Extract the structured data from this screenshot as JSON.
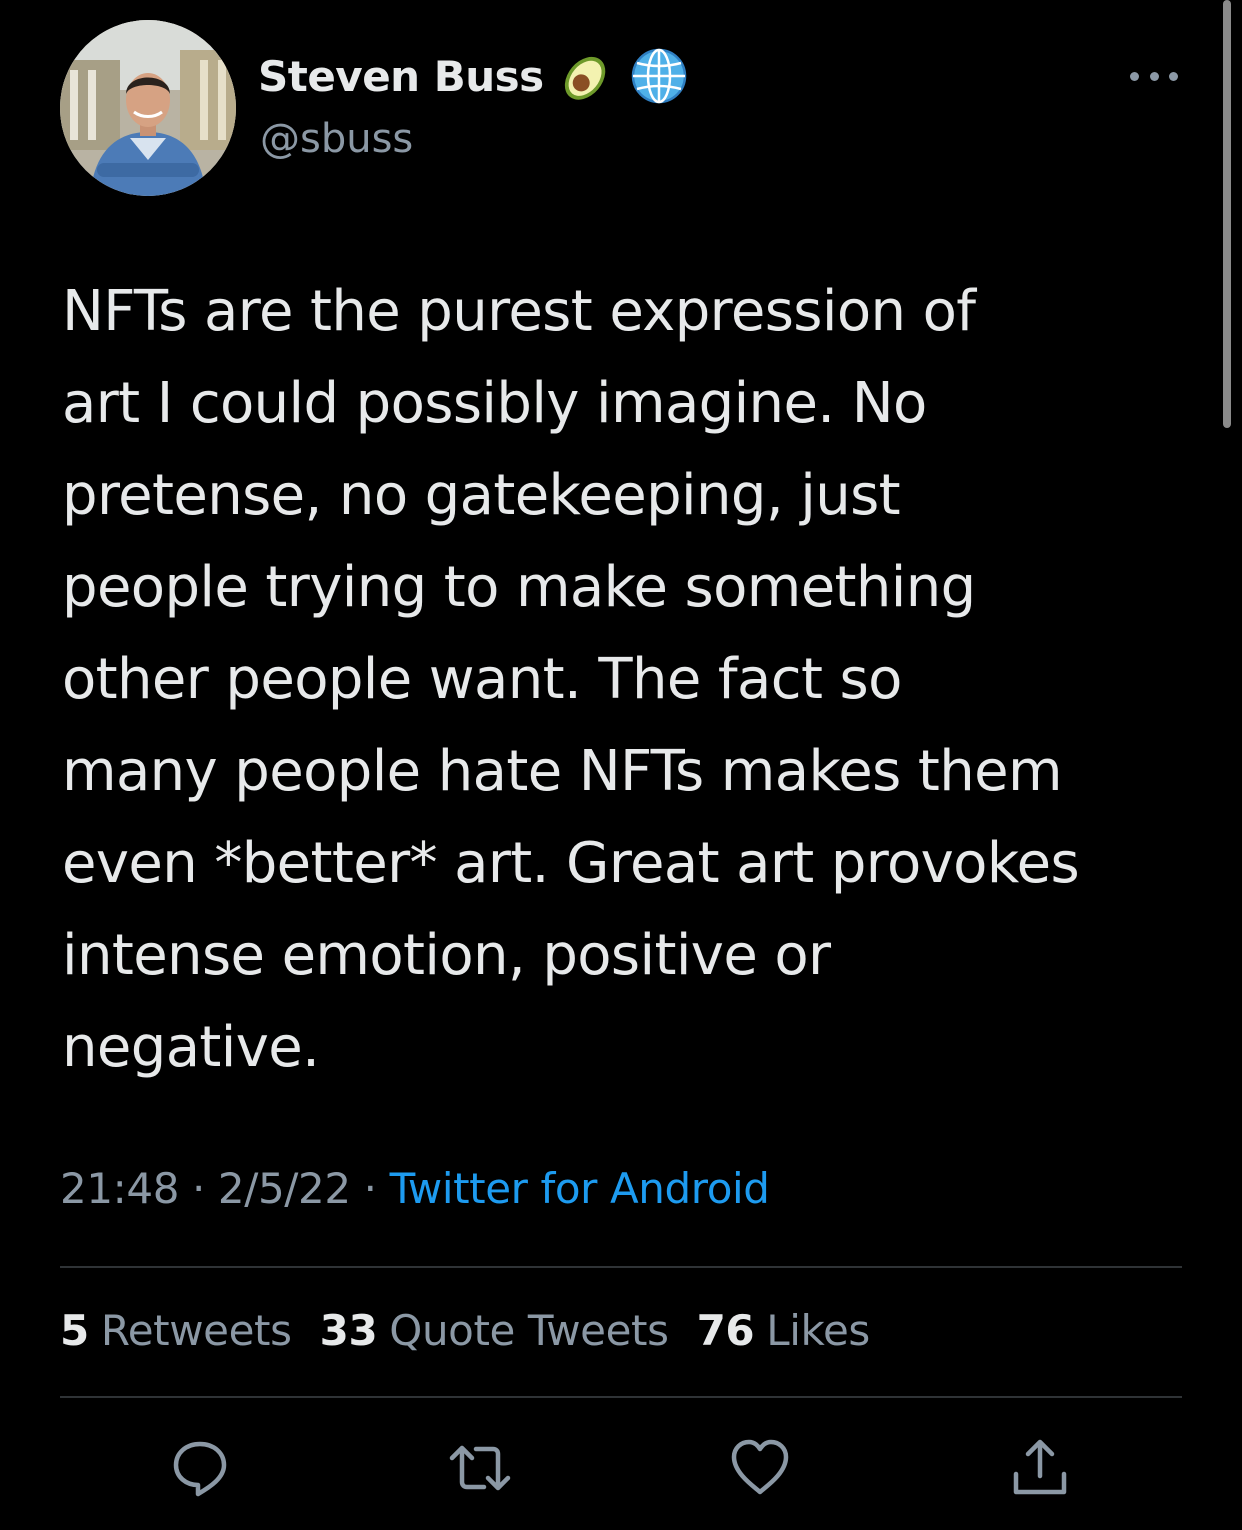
{
  "colors": {
    "background": "#000000",
    "text_primary": "#e7e9ea",
    "text_secondary": "#8b98a5",
    "accent": "#1d9bf0",
    "divider": "#2f3336"
  },
  "author": {
    "display_name": "Steven Buss",
    "handle": "@sbuss",
    "name_emojis": [
      "avocado-icon",
      "globe-icon"
    ]
  },
  "tweet": {
    "lines": [
      "NFTs are the purest expression of",
      "art I could possibly imagine. No",
      "pretense, no gatekeeping, just",
      "people trying to make something",
      "other people want. The fact so",
      "many people hate NFTs makes them",
      "even *better* art. Great art provokes",
      "intense emotion, positive or",
      "negative."
    ]
  },
  "meta": {
    "time": "21:48",
    "date": "2/5/22",
    "separator": " · ",
    "source": "Twitter for Android"
  },
  "stats": {
    "retweets_count": "5",
    "retweets_label": "Retweets",
    "quote_count": "33",
    "quote_label": "Quote Tweets",
    "likes_count": "76",
    "likes_label": "Likes"
  },
  "actions": [
    "reply-icon",
    "retweet-icon",
    "like-icon",
    "share-icon"
  ]
}
